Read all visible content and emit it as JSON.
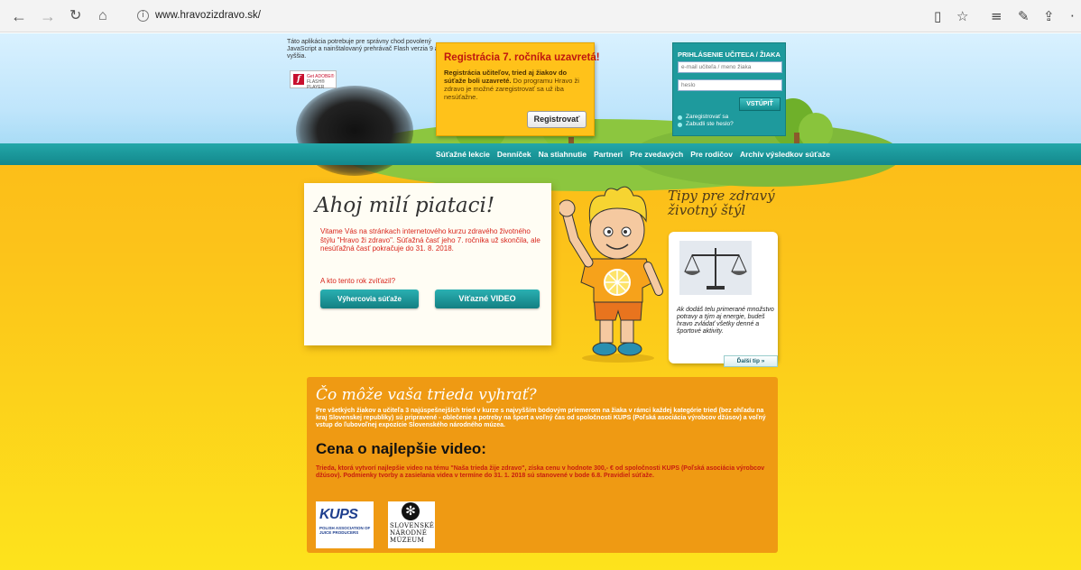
{
  "browser": {
    "url": "www.hravozizdravo.sk/"
  },
  "header": {
    "flash_message": "Táto aplikácia potrebuje pre správny chod povolený JavaScript a nainštalovaný prehrávač Flash verzia 9 a vyššia.",
    "flash_badge_top": "Get ADOBE®",
    "flash_badge_bottom": "FLASH® PLAYER",
    "registration": {
      "title": "Registrácia 7. ročníka uzavretá!",
      "text_bold": "Registrácia učiteľov, tried aj žiakov do súťaže boli uzavreté.",
      "text_rest": "Do programu Hravo ži zdravo je možné zaregistrovať sa už iba nesúťažne.",
      "button": "Registrovať"
    },
    "login": {
      "title": "PRIHLÁSENIE UČITEĽA / ŽIAKA",
      "email_placeholder": "e-mail učiteľa / meno žiaka",
      "password_placeholder": "heslo",
      "submit": "VSTÚPIŤ",
      "register_link": "Zaregistrovať sa",
      "forgot_link": "Zabudli ste heslo?"
    }
  },
  "nav": {
    "items": [
      "Súťažné lekcie",
      "Denníček",
      "Na stiahnutie",
      "Partneri",
      "Pre zvedavých",
      "Pre rodičov",
      "Archív výsledkov súťaže"
    ]
  },
  "welcome": {
    "title": "Ahoj milí piataci!",
    "text": "Vitame Vás na stránkach internetového kurzu zdravého životného štýlu \"Hravo ži zdravo\". Súťažná časť jeho 7. ročníka už skončila, ale nesúťažná časť pokračuje do 31. 8. 2018.",
    "question": "A kto tento rok zvíťazil?",
    "btn_winners": "Výhercovia súťaže",
    "btn_video": "Víťazné VIDEO"
  },
  "tips": {
    "title_line1": "Tipy pre zdravý",
    "title_line2": "životný štýl",
    "text": "Ak dodáš telu primerané množstvo potravy a tým aj energie, budeš hravo zvládať všetky denné a športové aktivity.",
    "next": "Ďalší tip »"
  },
  "prize": {
    "title": "Čo môže vaša trieda vyhrať?",
    "text": "Pre všetkých žiakov a učiteľa 3 najúspešnejších tried v kurze s najvyšším bodovým priemerom na žiaka v rámci každej kategórie tried (bez ohľadu na kraj Slovenskej republiky) sú pripravené - oblečenie a potreby na šport a voľný čas od spoločnosti KUPS (Poľská asociácia výrobcov džúsov) a voľný vstup do ľubovoľnej expozície Slovenského národného múzea.",
    "heading": "Cena o najlepšie video:",
    "text2": "Trieda, ktorá vytvorí najlepšie video na tému \"Naša trieda žije zdravo\", získa cenu v hodnote 300,- € od spoločnosti KUPS (Poľská asociácia výrobcov džúsov). Podmienky tvorby a zasielania videa v termíne do 31. 1. 2018 sú stanovené v bode 6.8. Pravidiel súťaže.",
    "logo_kups": "KUPS",
    "logo_kups_sub": "POLISH ASSOCIATION OF JUICE PRODUCERS",
    "logo_museum": "SLOVENSKÉ NÁRODNÉ MÚZEUM"
  },
  "colors": {
    "teal": "#1e9a9d",
    "orange": "#ef9a13",
    "red_text": "#d8261d",
    "registration_bg": "#ffc21a"
  }
}
